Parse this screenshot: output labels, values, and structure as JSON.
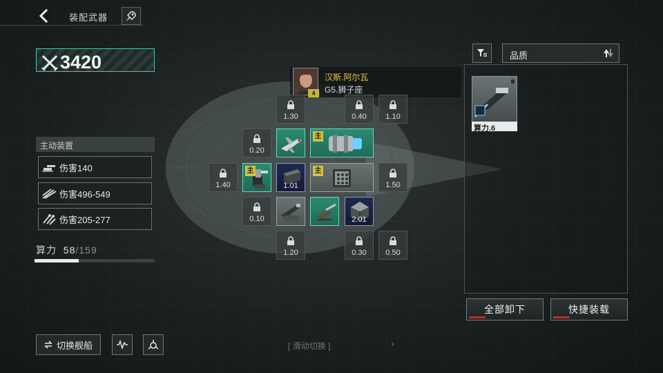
{
  "header": {
    "title": "装配武器",
    "back_icon": "chevron-left-icon",
    "ship_icon": "rocket-icon"
  },
  "power": {
    "icon": "crossed-swords-icon",
    "value": "3420"
  },
  "active_devices": {
    "title": "主动装置",
    "items": [
      {
        "icon": "turret-icon",
        "label": "伤害140"
      },
      {
        "icon": "missile-swarm-icon",
        "label": "伤害496-549"
      },
      {
        "icon": "multi-missile-icon",
        "label": "伤害205-277"
      }
    ]
  },
  "compute": {
    "label": "算力",
    "used": "58",
    "total": "/159",
    "ratio": 0.365
  },
  "captain": {
    "name": "汉斯.阿尔瓦",
    "rank": "G5.狮子座",
    "level": "4"
  },
  "slots": {
    "locked": [
      {
        "id": "lock-1",
        "cost": "1.30"
      },
      {
        "id": "lock-2",
        "cost": "0.40"
      },
      {
        "id": "lock-3",
        "cost": "1.10"
      },
      {
        "id": "lock-4",
        "cost": "0.20"
      },
      {
        "id": "lock-5",
        "cost": "1.40"
      },
      {
        "id": "lock-6",
        "cost": "1.50"
      },
      {
        "id": "lock-7",
        "cost": "0.10"
      },
      {
        "id": "lock-8",
        "cost": "1.20"
      },
      {
        "id": "lock-9",
        "cost": "0.30"
      },
      {
        "id": "lock-10",
        "cost": "0.50"
      }
    ],
    "equipped": [
      {
        "id": "eq-fighter",
        "cost": ""
      },
      {
        "id": "eq-cannon-big",
        "cost": "",
        "badge": "主"
      },
      {
        "id": "eq-turret",
        "cost": "",
        "badge": "主"
      },
      {
        "id": "eq-block",
        "cost": "1.01"
      },
      {
        "id": "eq-missile-box",
        "cost": "",
        "badge": "主"
      },
      {
        "id": "eq-launcher",
        "cost": ""
      },
      {
        "id": "eq-gatling",
        "cost": ""
      },
      {
        "id": "eq-crate",
        "cost": "2.01"
      }
    ]
  },
  "right_panel": {
    "filter_icon": "filter-icon",
    "sort_label": "品质",
    "sort_icon": "sort-arrows-icon",
    "items": [
      {
        "label": "算力.6"
      }
    ],
    "unequip_all": "全部卸下",
    "quick_equip": "快捷装载"
  },
  "bottom": {
    "switch_ship": "切换舰船",
    "swipe_hint": "滑动切换",
    "swipe_left": "[",
    "swipe_right": "]",
    "swipe_arrow": "›"
  },
  "colors": {
    "accent_teal": "#5bc2a8",
    "captain_gold": "#e1c54a",
    "main_badge": "#d6c23a",
    "tag_red": "#b23030"
  }
}
